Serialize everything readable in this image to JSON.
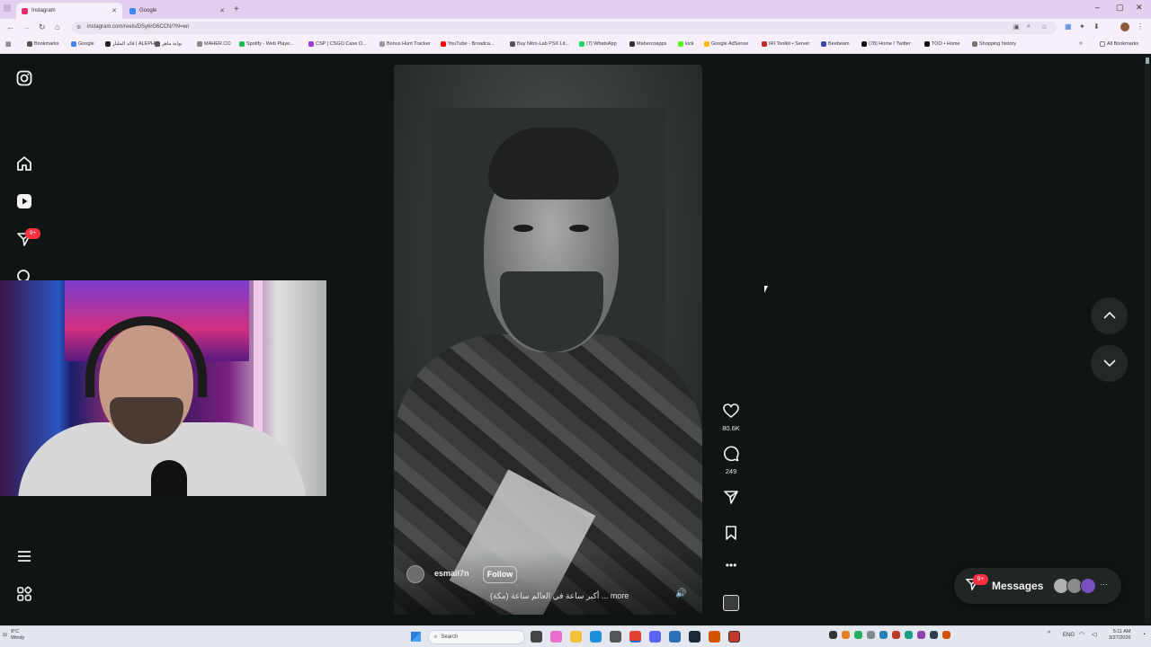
{
  "browser": {
    "tabs": [
      {
        "title": "Instagram",
        "active": true,
        "favicon_color": "#e1306c"
      },
      {
        "title": "Google",
        "active": false,
        "favicon_color": "#4285f4"
      }
    ],
    "new_tab": "+",
    "url": "instagram.com/reels/DSy6rG6CCN/?hl=en",
    "bookmarks": [
      {
        "label": "Bookmarks",
        "color": "#555"
      },
      {
        "label": "Google",
        "color": "#4285f4"
      },
      {
        "label": "قائد المليار | ALEPH...",
        "color": "#222"
      },
      {
        "label": "بوابة ماهر",
        "color": "#555"
      },
      {
        "label": "MAHER.CO",
        "color": "#888"
      },
      {
        "label": "Spotify - Web Playe...",
        "color": "#1db954"
      },
      {
        "label": "CSP | CSGO Case O...",
        "color": "#9b3dd0"
      },
      {
        "label": "Bonus Hunt Tracker",
        "color": "#999"
      },
      {
        "label": "YouTube - Broadca...",
        "color": "#ff0000"
      },
      {
        "label": "Buy Nitro-Lab PSX Lit...",
        "color": "#555"
      },
      {
        "label": "(7) WhatsApp",
        "color": "#25d366"
      },
      {
        "label": "Mahercoapps",
        "color": "#333"
      },
      {
        "label": "kick",
        "color": "#53fc18"
      },
      {
        "label": "Google AdSense",
        "color": "#fbbc04"
      },
      {
        "label": "IRI Toolkit • Server",
        "color": "#c62828"
      },
      {
        "label": "Beebeam",
        "color": "#3949ab"
      },
      {
        "label": "(78) Home / Twitter",
        "color": "#111"
      },
      {
        "label": "TOO • Home",
        "color": "#111"
      },
      {
        "label": "Shopping history",
        "color": "#777"
      }
    ],
    "all_bookmarks": "All Bookmarks"
  },
  "instagram": {
    "sidebar": {
      "notification_badge": "9+",
      "icons": [
        "instagram-logo",
        "home",
        "reels",
        "direct",
        "search",
        "more",
        "also-from-meta"
      ]
    },
    "reel": {
      "username": "esmail7n",
      "follow_label": "Follow",
      "caption": "أكبر ساعة في العالم ساعة (مكة) ... more",
      "likes": "80.6K",
      "comments": "249"
    },
    "messages": {
      "label": "Messages",
      "badge": "9+",
      "avatar_colors": [
        "#b0b0b0",
        "#8a8a8a",
        "#7a4fc0"
      ]
    },
    "colors": {
      "background": "#0f1514",
      "badge": "#ff3040"
    }
  },
  "taskbar": {
    "weather_temp": "9°C",
    "weather_desc": "Windy",
    "search_placeholder": "Search",
    "tray_lang": "ENG",
    "time": "5:11 AM",
    "date": "3/27/2026"
  }
}
